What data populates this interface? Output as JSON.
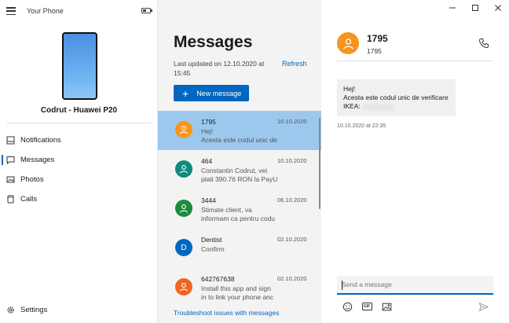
{
  "app": {
    "title": "Your Phone"
  },
  "device": {
    "name": "Codrut - Huawei P20"
  },
  "nav": {
    "items": [
      {
        "label": "Notifications",
        "icon": "notifications-icon",
        "active": false
      },
      {
        "label": "Messages",
        "icon": "messages-icon",
        "active": true
      },
      {
        "label": "Photos",
        "icon": "photos-icon",
        "active": false
      },
      {
        "label": "Calls",
        "icon": "calls-icon",
        "active": false
      }
    ],
    "settings": "Settings"
  },
  "messages": {
    "heading": "Messages",
    "last_updated": "Last updated on 12.10.2020 at 15:45",
    "refresh": "Refresh",
    "new_message": "New message",
    "troubleshoot": "Troubleshoot issues with messages",
    "conversations": [
      {
        "from": "1795",
        "date": "10.10.2020",
        "preview_1": "Hej!",
        "preview_2": "Acesta este codul unic de",
        "avatar_color": "#f7941d",
        "avatar_type": "person",
        "selected": true
      },
      {
        "from": "464",
        "date": "10.10.2020",
        "preview_1": "Constantin Codrut, vei",
        "preview_2": "plati 390.76 RON la PayU",
        "avatar_color": "#0e8a7e",
        "avatar_type": "person",
        "selected": false
      },
      {
        "from": "3444",
        "date": "06.10.2020",
        "preview_1": "Stimate client, va",
        "preview_2": "informam ca pentru codu",
        "avatar_color": "#1e8a3c",
        "avatar_type": "person",
        "selected": false
      },
      {
        "from": "Dentist",
        "date": "02.10.2020",
        "preview_1": "Confirm",
        "preview_2": "",
        "avatar_color": "#0067c0",
        "avatar_type": "letter",
        "avatar_letter": "D",
        "selected": false
      },
      {
        "from": "642767638",
        "date": "02.10.2020",
        "preview_1": "Install this app and sign",
        "preview_2": "in to link your phone anc",
        "avatar_color": "#f26522",
        "avatar_type": "person",
        "selected": false
      }
    ]
  },
  "conversation": {
    "name": "1795",
    "number": "1795",
    "avatar_color": "#f7941d",
    "message_lines": [
      "Hej!",
      "Acesta este codul unic de verificare",
      "IKEA:"
    ],
    "timestamp": "10.10.2020 at 22:35",
    "compose_placeholder": "Send a message"
  },
  "colors": {
    "accent": "#0067c0",
    "selected_row": "#9dc8ee"
  }
}
